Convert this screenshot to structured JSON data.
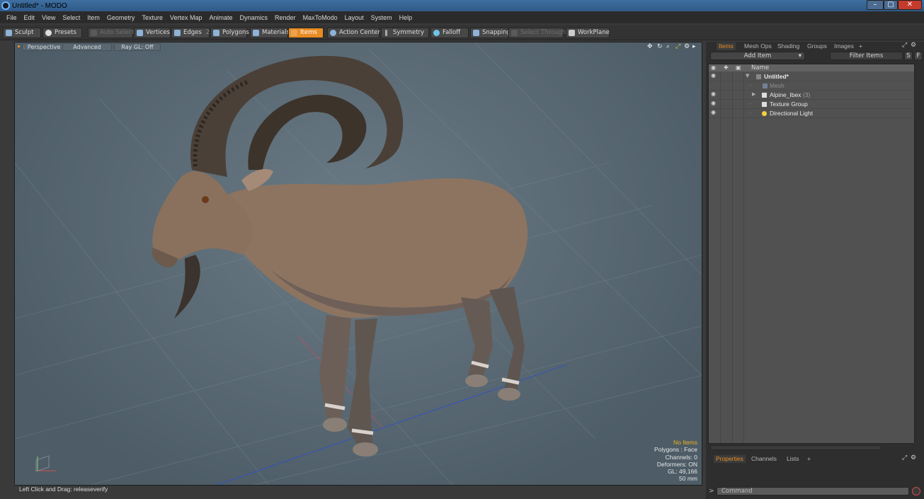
{
  "window": {
    "title": "Untitled* - MODO"
  },
  "menu": [
    "File",
    "Edit",
    "View",
    "Select",
    "Item",
    "Geometry",
    "Texture",
    "Vertex Map",
    "Animate",
    "Dynamics",
    "Render",
    "MaxToModo",
    "Layout",
    "System",
    "Help"
  ],
  "toolbar": {
    "sculpt": "Sculpt",
    "presets": "Presets",
    "auto_select": "Auto Select",
    "vertices": "Vertices",
    "edges": "Edges",
    "edges_count": "2",
    "polygons": "Polygons",
    "materials": "Materials",
    "items": "Items",
    "action_center": "Action Center",
    "symmetry": "Symmetry",
    "falloff": "Falloff",
    "snapping": "Snapping",
    "select_through": "Select Through",
    "workplane": "WorkPlane"
  },
  "viewport": {
    "tabs": [
      "Perspective",
      "Advanced",
      "Ray GL: Off"
    ],
    "info": {
      "no_items": "No Items",
      "polygons": "Polygons : Face",
      "channels": "Channels: 0",
      "deformers": "Deformers: ON",
      "gl": "GL: 49,166",
      "mm": "50 mm"
    },
    "status": "Left Click and Drag:  releaseverify"
  },
  "panel": {
    "tabs": [
      "Items",
      "Mesh Ops",
      "Shading",
      "Groups",
      "Images",
      "+"
    ],
    "add_item": "Add Item",
    "filter_items": "Filter Items",
    "btn_s": "S",
    "btn_f": "F",
    "name_col": "Name",
    "rows": [
      {
        "label": "Untitled*",
        "count": ""
      },
      {
        "label": "Mesh",
        "count": ""
      },
      {
        "label": "Alpine_Ibex",
        "count": "(3)"
      },
      {
        "label": "Texture Group",
        "count": ""
      },
      {
        "label": "Directional Light",
        "count": ""
      }
    ],
    "bottom_tabs": [
      "Properties",
      "Channels",
      "Lists",
      "+"
    ],
    "command_placeholder": "Command"
  },
  "colors": {
    "accent": "#e88b23",
    "viewport_bg": "#5b6a74"
  }
}
